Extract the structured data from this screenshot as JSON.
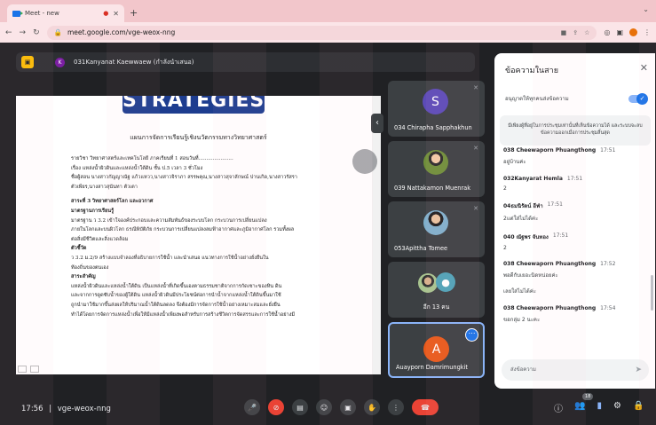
{
  "browser": {
    "tab_title": "Meet - new",
    "tab_indicator": "●",
    "close": "✕",
    "new_tab": "+",
    "url": "meet.google.com/vge-weox-nng"
  },
  "presenter": {
    "initial": "K",
    "name": "031Kanyanat Kaewwaew (กำลังนำเสนอ)"
  },
  "document": {
    "banner": "STRATEGIES",
    "title": "แผนการจัดการเรียนรู้เชิงนวัตกรรมทางวิทยาศาสตร์",
    "lines": [
      {
        "text": "รายวิชา วิทยาศาสตร์และเทคโนโลยี          ภาคเรียนที่ 1          สอนวันที่......................",
        "bold": false
      },
      {
        "text": "เรื่อง แหล่งน้ำผิวดินและแหล่งน้ำใต้ดิน          ชั้น ป.5          เวลา 3 ชั่วโมง",
        "bold": false
      },
      {
        "text": "ชื่อผู้สอน นางสาวกัญญาณัฐ แก้วแหวว,นางสาวจิราภา สรรพคุณ,นางสาวสุจาลักษณ์ ปานเกิด,นางสาวรัสรา",
        "bold": false
      },
      {
        "text": "ตัวเพียร,นางสาวสุนันทา ตัวเตา",
        "bold": false
      },
      {
        "text": "",
        "bold": false
      },
      {
        "text": "สาระที่ 3 วิทยาศาสตร์โลก และอวกาศ",
        "bold": true
      },
      {
        "text": "มาตรฐานการเรียนรู้",
        "bold": true
      },
      {
        "text": "     มาตรฐาน ว 3.2 เข้าใจองค์ประกอบและความสัมพันธ์ของระบบโลก กระบวนการเปลี่ยนแปลง",
        "bold": false
      },
      {
        "text": "ภายในโลกและบนผิวโลก ธรณีพิบัติภัย กระบวนการเปลี่ยนแปลงลมฟ้าอากาศและภูมิอากาศโลก รวมทั้งผล",
        "bold": false
      },
      {
        "text": "ต่อสิ่งมีชีวิตและสิ่งแวดล้อม",
        "bold": false
      },
      {
        "text": "ตัวชี้วัด",
        "bold": true
      },
      {
        "text": "     ว 3.2 ม.2/9 สร้างแบบจำลองที่อธิบายการใช้น้ำ และนำเสนอ แนวทางการใช้น้ำอย่างยั่งยืนใน",
        "bold": false
      },
      {
        "text": "ท้องถิ่นของตนเอง",
        "bold": false
      },
      {
        "text": "สาระสำคัญ",
        "bold": true
      },
      {
        "text": "     แหล่งน้ำผิวดินและแหล่งน้ำใต้ดิน เป็นแหล่งน้ำที่เกิดขึ้นเองตามธรรมชาติจากการกัดเซาะของหิน ดิน",
        "bold": false
      },
      {
        "text": "และจากการดูดซับน้ำของผู้ใต้ดิน แหล่งน้ำผิวดินมีประโยชน์ต่อการนำน้ำจากแหล่งน้ำใต้ดินขึ้นมาใช้",
        "bold": false
      },
      {
        "text": "ถูกนำมาใช้มากขึ้นส่งผลให้ปริมาณน้ำใต้ดินลดลง จึงต้องมีการจัดการใช้น้ำอย่างเหมาะสมและยั่งยืน",
        "bold": false
      },
      {
        "text": "ทำได้โดยการจัดการแหล่งน้ำเพื่อให้มีแหล่งน้ำเพียงพอสำหรับการสร้างชีวิตการจัดสรรและการใช้น้ำอย่างมี",
        "bold": false
      }
    ]
  },
  "participants": [
    {
      "name": "034 Chirapha Sapphakhun",
      "initial": "S",
      "color": "#5c4bb8"
    },
    {
      "name": "039 Nattakamon Muenrak"
    },
    {
      "name": "053Apittha Tomee"
    },
    {
      "name": "อีก 13 คน"
    },
    {
      "name": "Auayporn Damrimungkit",
      "initial": "A",
      "color": "#e8591a"
    }
  ],
  "chat": {
    "title": "ข้อความในสาย",
    "close": "✕",
    "toggle_label": "อนุญาตให้ทุกคนส่งข้อความ",
    "notice": "มีเพียงผู้ที่อยู่ในการประชุมเท่านั้นที่เห็นข้อความได้ และระบบจะลบข้อความออกเมื่อการประชุมสิ้นสุด",
    "messages": [
      {
        "sender": "038 Cheewaporn Phuangthong",
        "time": "17:51",
        "text": "อยู่บ้านค่ะ"
      },
      {
        "sender": "032Kanyarat Hemla",
        "time": "17:51",
        "text": "2"
      },
      {
        "sender": "04ธมนิรัตน์ อีฟ่า",
        "time": "17:51",
        "text": "2แต่ใส่ไม่ได้ค่ะ"
      },
      {
        "sender": "040 ณัฐพร จันทอง",
        "time": "17:51",
        "text": "2"
      },
      {
        "sender": "038 Cheewaporn Phuangthong",
        "time": "17:52",
        "text": "พอดีกับเยอะนิดหน่อยค่ะ"
      },
      {
        "sender": "",
        "time": "",
        "text": "เลยใส่ไม่ได้ค่ะ"
      },
      {
        "sender": "038 Cheewaporn Phuangthong",
        "time": "17:54",
        "text": "ขอกลุ่ม 2 นะคะ"
      }
    ],
    "input_placeholder": "ส่งข้อความ"
  },
  "bottom": {
    "time": "17:56",
    "separator": "|",
    "code": "vge-weox-nng",
    "participant_count": "18"
  },
  "colors": {
    "end_call": "#ea4335",
    "accent": "#1a73e8"
  }
}
